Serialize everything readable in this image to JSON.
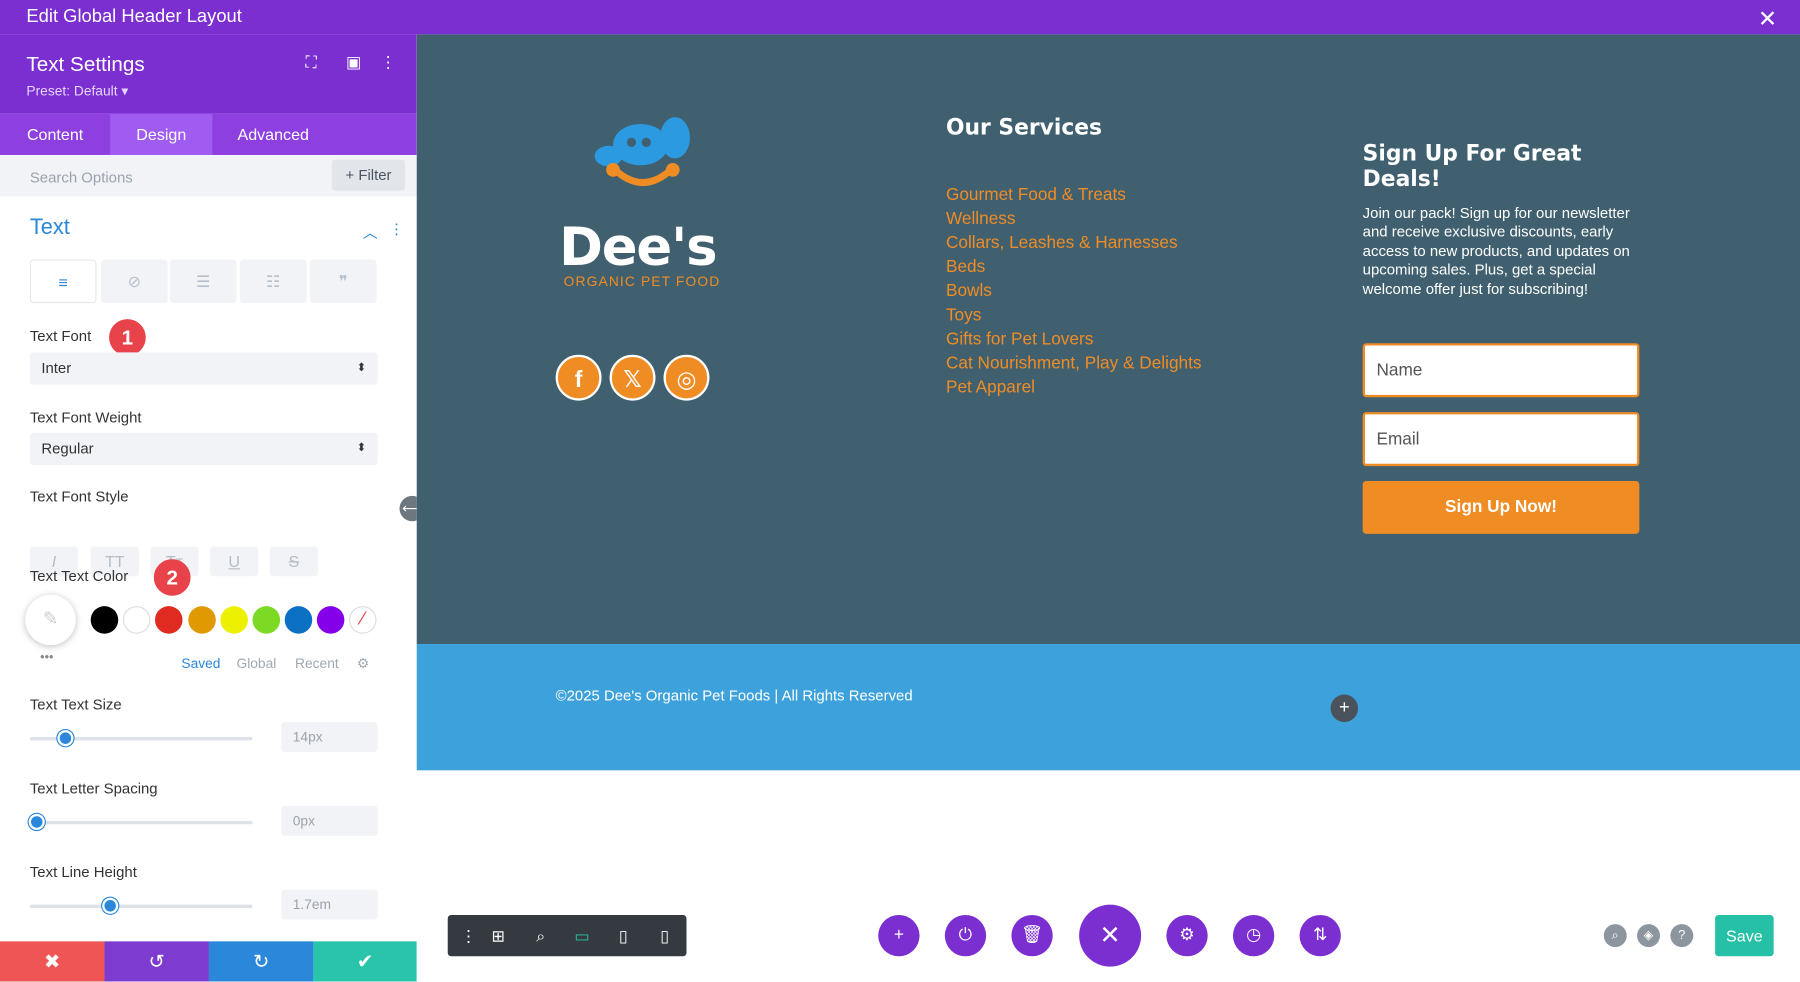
{
  "topbar": {
    "title": "Edit Global Header Layout",
    "close": "✕"
  },
  "panel": {
    "title": "Text Settings",
    "preset": "Preset: Default ▾",
    "tabs": [
      "Content",
      "Design",
      "Advanced"
    ],
    "search_placeholder": "Search Options",
    "filter_label": "+ Filter",
    "section": "Text",
    "font_label": "Text Font",
    "font_value": "Inter",
    "weight_label": "Text Font Weight",
    "weight_value": "Regular",
    "style_label": "Text Font Style",
    "color_label": "Text Text Color",
    "badge1": "1",
    "badge2": "2",
    "color_tabs": [
      "Saved",
      "Global",
      "Recent"
    ],
    "more": "•••",
    "size_label": "Text Text Size",
    "size_value": "14px",
    "size_pct": 0.16,
    "spacing_label": "Text Letter Spacing",
    "spacing_value": "0px",
    "spacing_pct": 0.03,
    "lh_label": "Text Line Height",
    "lh_value": "1.7em",
    "lh_pct": 0.36,
    "swatches": [
      "#000000",
      "#ffffff",
      "#e02b20",
      "#e09900",
      "#edf000",
      "#7cda24",
      "#0c71c3",
      "#8300e9"
    ]
  },
  "footer": {
    "logo_name": "Dee's",
    "logo_sub": "ORGANIC PET FOOD",
    "services_title": "Our Services",
    "services": [
      "Gourmet Food & Treats",
      "Wellness",
      "Collars, Leashes & Harnesses",
      "Beds",
      "Bowls",
      "Toys",
      "Gifts for Pet Lovers",
      "Cat Nourishment, Play & Delights",
      "Pet Apparel"
    ],
    "signup_title_1": "Sign Up For Great",
    "signup_title_2": "Deals!",
    "signup_text": "Join our pack! Sign up for our newsletter and receive exclusive discounts, early access to new products, and updates on upcoming sales. Plus, get a special welcome offer just for subscribing!",
    "name_placeholder": "Name",
    "email_placeholder": "Email",
    "button": "Sign Up Now!",
    "copyright": "©2025 Dee's Organic Pet Foods | All Rights Reserved"
  },
  "save_label": "Save"
}
